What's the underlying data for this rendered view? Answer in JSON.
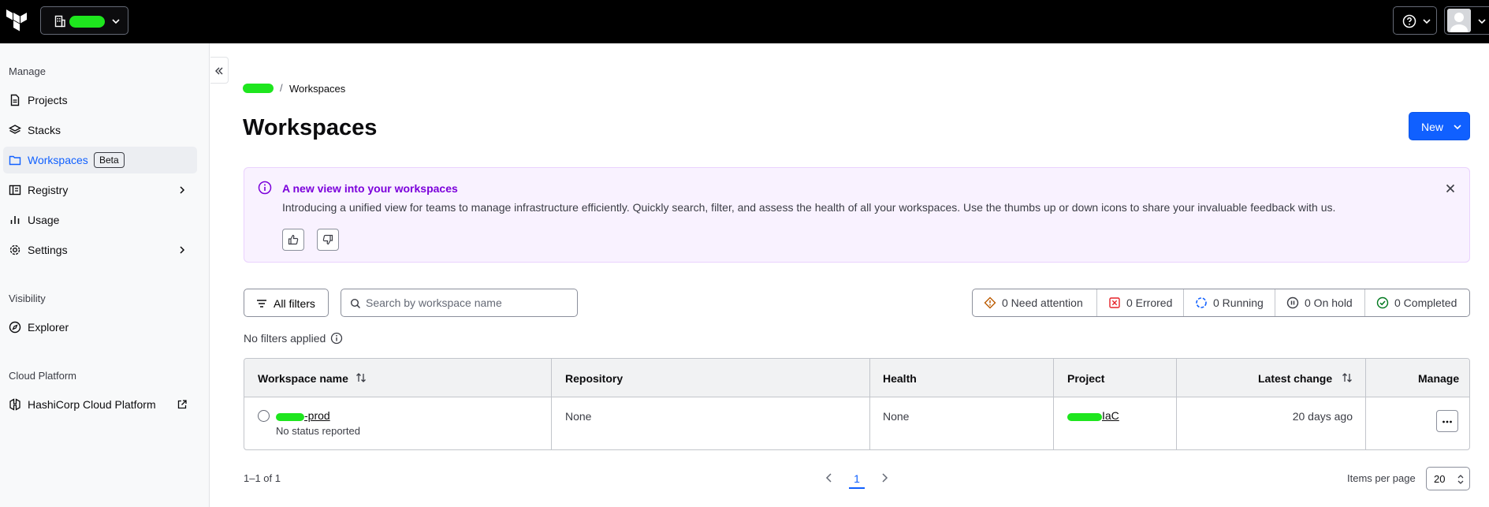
{
  "org_switcher": {
    "org_name_redacted": true
  },
  "sidebar": {
    "sections": [
      {
        "heading": "Manage"
      },
      {
        "heading": "Visibility"
      },
      {
        "heading": "Cloud Platform"
      }
    ],
    "items": [
      {
        "label": "Projects",
        "icon": "file-icon"
      },
      {
        "label": "Stacks",
        "icon": "layers-icon"
      },
      {
        "label": "Workspaces",
        "icon": "folder-icon",
        "badge": "Beta",
        "active": true
      },
      {
        "label": "Registry",
        "icon": "registry-icon",
        "has_submenu": true
      },
      {
        "label": "Usage",
        "icon": "bar-chart-icon"
      },
      {
        "label": "Settings",
        "icon": "gear-icon",
        "has_submenu": true
      },
      {
        "label": "Explorer",
        "icon": "compass-icon"
      },
      {
        "label": "HashiCorp Cloud Platform",
        "icon": "hashicorp-icon",
        "external": true
      }
    ]
  },
  "breadcrumb": {
    "separator": "/",
    "current": "Workspaces"
  },
  "page": {
    "title": "Workspaces",
    "new_button": "New"
  },
  "banner": {
    "title": "A new view into your workspaces",
    "body": "Introducing a unified view for teams to manage infrastructure efficiently. Quickly search, filter, and assess the health of all your workspaces. Use the thumbs up or down icons to share your invaluable feedback with us.",
    "accent": "#7b00db"
  },
  "toolbar": {
    "filters_label": "All filters",
    "search_placeholder": "Search by workspace name",
    "no_filters": "No filters applied"
  },
  "status_counts": [
    {
      "label": "0 Need attention",
      "icon": "alert-diamond-icon",
      "color": "#bb5a00"
    },
    {
      "label": "0 Errored",
      "icon": "x-square-icon",
      "color": "#e52228"
    },
    {
      "label": "0 Running",
      "icon": "running-icon",
      "color": "#1060ff"
    },
    {
      "label": "0 On hold",
      "icon": "pause-circle-icon",
      "color": "#3b3d45"
    },
    {
      "label": "0 Completed",
      "icon": "check-circle-icon",
      "color": "#00781e"
    }
  ],
  "table": {
    "columns": [
      "Workspace name",
      "Repository",
      "Health",
      "Project",
      "Latest change",
      "Manage"
    ],
    "rows": [
      {
        "workspace_suffix": "-prod",
        "status": "No status reported",
        "repository": "None",
        "health": "None",
        "project_suffix": "IaC",
        "latest_change": "20 days ago"
      }
    ]
  },
  "pagination": {
    "range": "1–1 of 1",
    "current_page": "1",
    "items_per_page_label": "Items per page",
    "items_per_page": "20"
  },
  "colors": {
    "brand_blue": "#1060ff",
    "topbar": "#000000"
  }
}
